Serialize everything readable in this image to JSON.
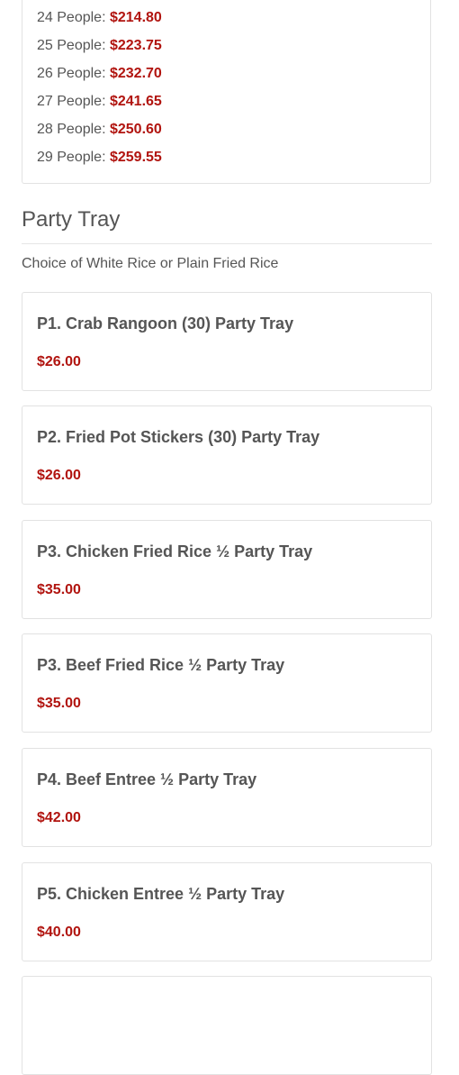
{
  "price_list": [
    {
      "label": "24 People:",
      "amount": "$214.80"
    },
    {
      "label": "25 People:",
      "amount": "$223.75"
    },
    {
      "label": "26 People:",
      "amount": "$232.70"
    },
    {
      "label": "27 People:",
      "amount": "$241.65"
    },
    {
      "label": "28 People:",
      "amount": "$250.60"
    },
    {
      "label": "29 People:",
      "amount": "$259.55"
    }
  ],
  "section": {
    "title": "Party Tray",
    "description": "Choice of White Rice or Plain Fried Rice"
  },
  "items": [
    {
      "name": "P1. Crab Rangoon (30) Party Tray",
      "price": "$26.00"
    },
    {
      "name": "P2. Fried Pot Stickers (30) Party Tray",
      "price": "$26.00"
    },
    {
      "name": "P3. Chicken Fried Rice ½ Party Tray",
      "price": "$35.00"
    },
    {
      "name": "P3. Beef Fried Rice ½ Party Tray",
      "price": "$35.00"
    },
    {
      "name": "P4. Beef Entree ½ Party Tray",
      "price": "$42.00"
    },
    {
      "name": "P5. Chicken Entree ½ Party Tray",
      "price": "$40.00"
    }
  ],
  "colors": {
    "price_accent": "#b1140f",
    "text": "#555555",
    "border": "#e2e2e2"
  }
}
